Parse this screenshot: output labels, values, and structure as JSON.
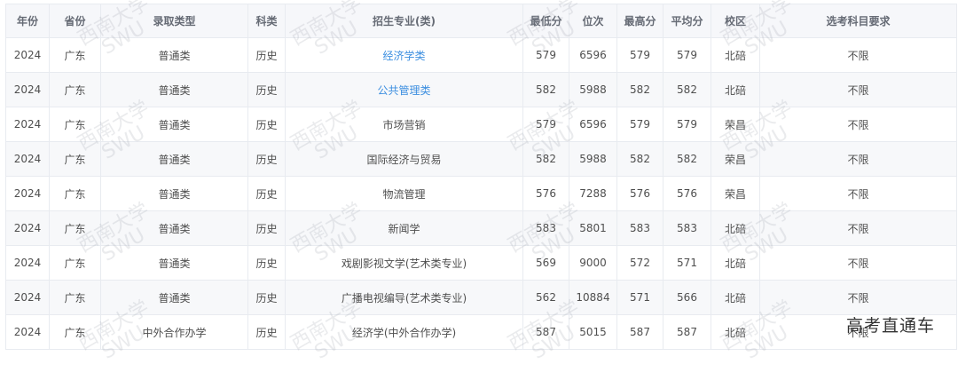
{
  "table": {
    "headers": [
      "年份",
      "省份",
      "录取类型",
      "科类",
      "招生专业(类)",
      "最低分",
      "位次",
      "最高分",
      "平均分",
      "校区",
      "选考科目要求"
    ],
    "rows": [
      [
        "2024",
        "广东",
        "普通类",
        "历史",
        "经济学类",
        "579",
        "6596",
        "579",
        "579",
        "北碚",
        "不限"
      ],
      [
        "2024",
        "广东",
        "普通类",
        "历史",
        "公共管理类",
        "582",
        "5988",
        "582",
        "582",
        "北碚",
        "不限"
      ],
      [
        "2024",
        "广东",
        "普通类",
        "历史",
        "市场营销",
        "579",
        "6596",
        "579",
        "579",
        "荣昌",
        "不限"
      ],
      [
        "2024",
        "广东",
        "普通类",
        "历史",
        "国际经济与贸易",
        "582",
        "5988",
        "582",
        "582",
        "荣昌",
        "不限"
      ],
      [
        "2024",
        "广东",
        "普通类",
        "历史",
        "物流管理",
        "576",
        "7288",
        "576",
        "576",
        "荣昌",
        "不限"
      ],
      [
        "2024",
        "广东",
        "普通类",
        "历史",
        "新闻学",
        "583",
        "5801",
        "583",
        "583",
        "北碚",
        "不限"
      ],
      [
        "2024",
        "广东",
        "普通类",
        "历史",
        "戏剧影视文学(艺术类专业)",
        "569",
        "9000",
        "572",
        "571",
        "北碚",
        "不限"
      ],
      [
        "2024",
        "广东",
        "普通类",
        "历史",
        "广播电视编导(艺术类专业)",
        "562",
        "10884",
        "571",
        "566",
        "北碚",
        "不限"
      ],
      [
        "2024",
        "广东",
        "中外合作办学",
        "历史",
        "经济学(中外合作办学)",
        "587",
        "5015",
        "587",
        "587",
        "北碚",
        "不限"
      ]
    ],
    "linked_rows": [
      0,
      1
    ]
  },
  "watermark": {
    "line1": "西南大学",
    "line2": "SWU"
  },
  "brand": "高考直通车",
  "colors": {
    "link": "#3d8fe0",
    "header_bg": "#f6f7fa",
    "stripe_bg": "#f7f8fa",
    "border": "#e8ebf0"
  }
}
